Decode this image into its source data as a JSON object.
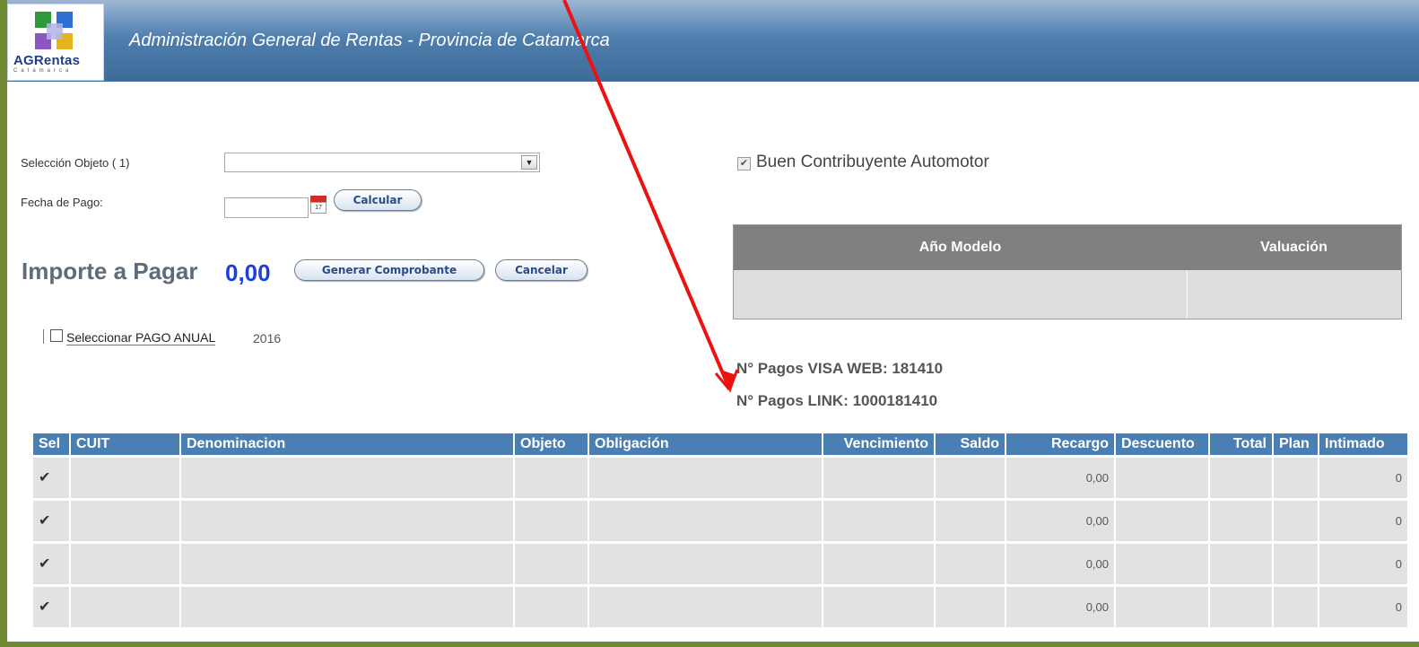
{
  "header": {
    "title": "Administración General de Rentas - Provincia de Catamarca",
    "logo_text": "AGRentas",
    "logo_subtext": "Catamarca"
  },
  "form": {
    "seleccion_label": "Selección Objeto ( 1)",
    "seleccion_value": "",
    "fecha_label": "Fecha de Pago:",
    "fecha_value": "",
    "calendar_day": "17",
    "calcular_label": "Calcular"
  },
  "importe": {
    "label": "Importe a Pagar",
    "value": "0,00",
    "generar_label": "Generar Comprobante",
    "cancelar_label": "Cancelar"
  },
  "anual": {
    "label": "Seleccionar PAGO ANUAL",
    "year": "2016",
    "checked": false
  },
  "buen_contribuyente": {
    "label": "Buen Contribuyente Automotor",
    "checked": true
  },
  "valuacion_table": {
    "col1": "Año Modelo",
    "col2": "Valuación"
  },
  "pagos": {
    "visa": "N° Pagos VISA WEB:  181410",
    "link": "N° Pagos LINK:  1000181410"
  },
  "grid": {
    "headers": [
      "Sel",
      "CUIT",
      "Denominacion",
      "Objeto",
      "Obligación",
      "Vencimiento",
      "Saldo",
      "Recargo",
      "Descuento",
      "Total",
      "Plan",
      "Intimado"
    ],
    "rows": [
      {
        "sel": "✔",
        "recargo": "0,00",
        "intimado": "0"
      },
      {
        "sel": "✔",
        "recargo": "0,00",
        "intimado": "0"
      },
      {
        "sel": "✔",
        "recargo": "0,00",
        "intimado": "0"
      },
      {
        "sel": "✔",
        "recargo": "0,00",
        "intimado": "0"
      }
    ]
  },
  "colors": {
    "frame": "#6f8a33",
    "header_grid": "#4a7fb3",
    "importe_value": "#1d3fe0",
    "arrow": "#ee1111"
  }
}
